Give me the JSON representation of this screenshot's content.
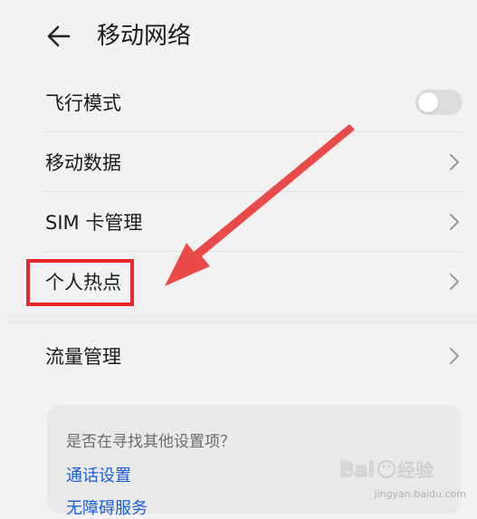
{
  "header": {
    "title": "移动网络"
  },
  "settings": {
    "items": [
      {
        "label": "飞行模式",
        "control": "toggle",
        "on": false
      },
      {
        "label": "移动数据",
        "control": "chevron"
      },
      {
        "label": "SIM 卡管理",
        "control": "chevron"
      },
      {
        "label": "个人热点",
        "control": "chevron",
        "highlighted": true
      },
      {
        "label": "流量管理",
        "control": "chevron"
      }
    ]
  },
  "suggestions": {
    "title": "是否在寻找其他设置项？",
    "links": [
      "通话设置",
      "无障碍服务"
    ]
  },
  "watermark": {
    "brand": "Baidu经验",
    "url": "jingyan.baidu.com"
  },
  "colors": {
    "highlight": "#e8262d",
    "arrow": "#e84a4a",
    "link": "#1a5fd6"
  }
}
